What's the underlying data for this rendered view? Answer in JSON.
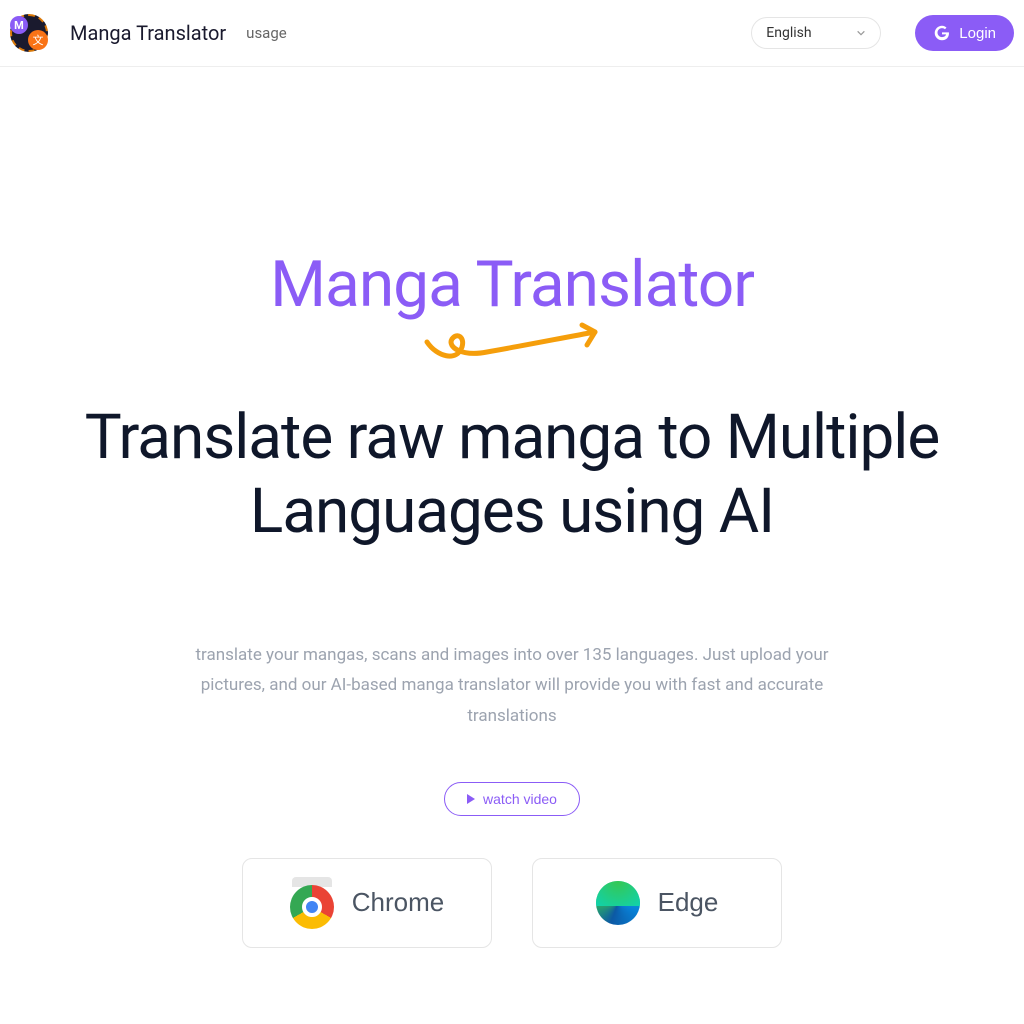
{
  "header": {
    "brand": "Manga Translator",
    "nav_usage": "usage",
    "language": "English",
    "login": "Login"
  },
  "hero": {
    "title_accent": "Manga Translator",
    "title_main": "Translate raw manga to Multiple Languages using AI",
    "subtitle": "translate your mangas, scans and images into over 135 languages. Just upload your pictures, and our AI-based manga translator will provide you with fast and accurate translations",
    "watch_video": "watch video"
  },
  "browsers": {
    "chrome": "Chrome",
    "edge": "Edge"
  }
}
